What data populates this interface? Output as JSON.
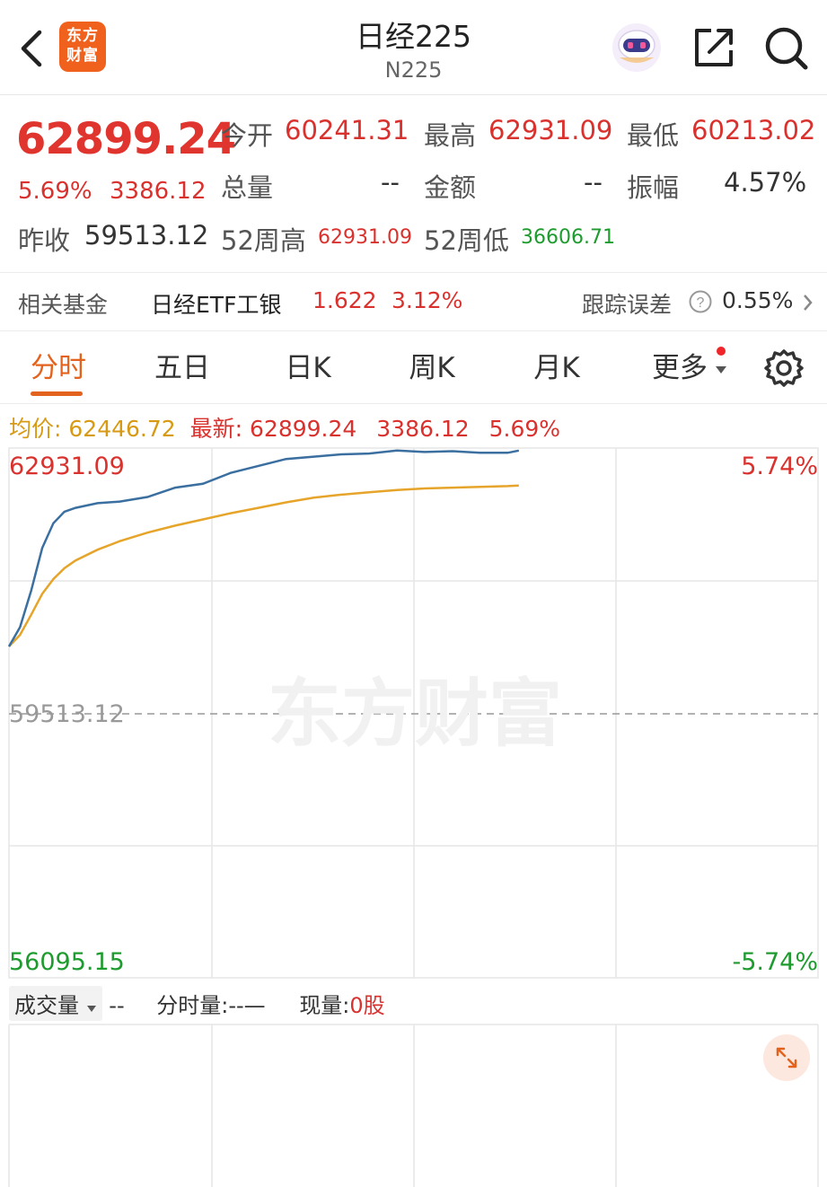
{
  "header": {
    "logo_line1": "东方",
    "logo_line2": "财富",
    "title": "日经225",
    "subtitle": "N225"
  },
  "quote": {
    "price": "62899.24",
    "change_pct": "5.69%",
    "change_abs": "3386.12",
    "prev_close_label": "昨收",
    "prev_close": "59513.12",
    "open_label": "今开",
    "open": "60241.31",
    "high_label": "最高",
    "high": "62931.09",
    "low_label": "最低",
    "low": "60213.02",
    "volume_label": "总量",
    "volume": "--",
    "amount_label": "金额",
    "amount": "--",
    "amplitude_label": "振幅",
    "amplitude": "4.57%",
    "w52_high_label": "52周高",
    "w52_high": "62931.09",
    "w52_low_label": "52周低",
    "w52_low": "36606.71"
  },
  "fund": {
    "label": "相关基金",
    "name": "日经ETF工银",
    "price": "1.622",
    "change": "3.12%",
    "tracking_label": "跟踪误差",
    "tracking_value": "0.55%"
  },
  "tabs": [
    "分时",
    "五日",
    "日K",
    "周K",
    "月K",
    "更多"
  ],
  "active_tab": "分时",
  "info": {
    "avg_label": "均价:",
    "avg_value": "62446.72",
    "latest_label": "最新:",
    "latest_value": "62899.24",
    "change_abs": "3386.12",
    "change_pct": "5.69%"
  },
  "chart": {
    "top_price": "62931.09",
    "top_pct": "5.74%",
    "mid_price": "59513.12",
    "bottom_price": "56095.15",
    "bottom_pct": "-5.74%",
    "watermark": "东方财富"
  },
  "chart_data": {
    "type": "line",
    "ylim": [
      56095.15,
      62931.09
    ],
    "reference": 59513.12,
    "x": [
      0,
      2,
      4,
      6,
      8,
      10,
      12,
      16,
      20,
      25,
      30,
      35,
      40,
      45,
      50,
      55,
      60,
      65,
      70,
      75,
      80,
      85,
      90,
      92
    ],
    "series": [
      {
        "name": "最新",
        "color": "#3a6fa0",
        "values": [
          60370,
          60620,
          61090,
          61640,
          61960,
          62110,
          62160,
          62220,
          62240,
          62300,
          62420,
          62470,
          62610,
          62700,
          62790,
          62820,
          62850,
          62860,
          62900,
          62880,
          62890,
          62870,
          62870,
          62899
        ]
      },
      {
        "name": "均价",
        "color": "#e6a52a",
        "values": [
          60370,
          60520,
          60780,
          61050,
          61240,
          61380,
          61480,
          61620,
          61730,
          61840,
          61930,
          62010,
          62090,
          62160,
          62230,
          62290,
          62330,
          62360,
          62390,
          62410,
          62420,
          62430,
          62440,
          62447
        ]
      }
    ]
  },
  "volume": {
    "selector": "成交量",
    "selector_value": "--",
    "tick_label": "分时量:",
    "tick_value": "--—",
    "now_label": "现量:",
    "now_value": "0股"
  }
}
